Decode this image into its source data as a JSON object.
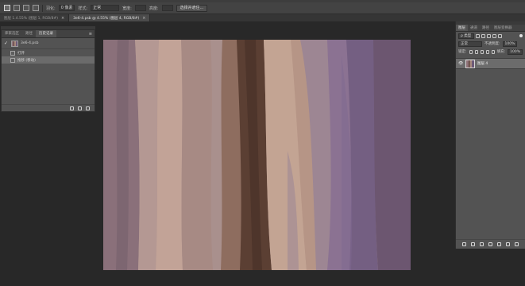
{
  "options_bar": {
    "style_label": "样式:",
    "style_value": "正常",
    "feather_label": "羽化:",
    "feather_value": "0 像素",
    "width_label": "宽度:",
    "height_label": "高度:",
    "select_mask_button": "选择并遮住..."
  },
  "tabs": [
    {
      "label": "图层 1.4.55% (图层 1, RGB/8#)"
    },
    {
      "label": "3e6-4.psb @ 4.55% (图层 4, RGB/8#)"
    }
  ],
  "history_panel": {
    "tabs": [
      "库家选区",
      "路径",
      "历史记录"
    ],
    "snapshot_name": "3e6-4.psb",
    "items": [
      {
        "label": "打开"
      },
      {
        "label": "拖移 (移动)"
      }
    ]
  },
  "layers_panel": {
    "tabs": [
      "图层",
      "通道",
      "路径",
      "图层变换器"
    ],
    "filter_value": "ρ 类型",
    "blend_mode": "正常",
    "opacity_label": "不透明度:",
    "opacity_value": "100%",
    "lock_label": "锁定:",
    "fill_label": "填充:",
    "fill_value": "100%",
    "layer_name": "图层 4"
  },
  "icons": {
    "check": "✓",
    "eye": "👁",
    "close": "×",
    "menu": "≡"
  },
  "colors": {
    "canvas_stripes": [
      "#8a7078",
      "#a9908b",
      "#c7a79b",
      "#6a4a3d",
      "#5a3d33",
      "#b39488",
      "#c5a697",
      "#9f8a96",
      "#8b7592",
      "#6d5977"
    ]
  }
}
